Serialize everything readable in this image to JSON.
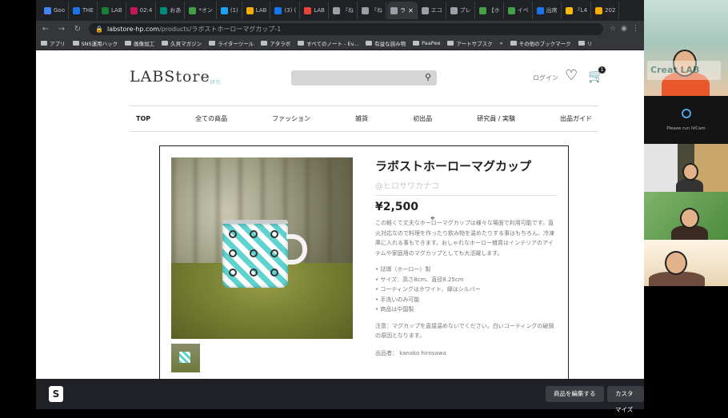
{
  "tabs": [
    {
      "label": "Goo",
      "color": "#4285f4"
    },
    {
      "label": "THE",
      "color": "#1a73e8"
    },
    {
      "label": "LAB",
      "color": "#188038"
    },
    {
      "label": "02:4",
      "color": "#c2185b"
    },
    {
      "label": "おあ",
      "color": "#00897b"
    },
    {
      "label": "*オン",
      "color": "#43a047"
    },
    {
      "label": "(1) ",
      "color": "#1da1f2"
    },
    {
      "label": "LAB",
      "color": "#f9ab00"
    },
    {
      "label": "(3) (",
      "color": "#1877f2"
    },
    {
      "label": "LAB",
      "color": "#ea4335"
    },
    {
      "label": "『ね",
      "color": "#9aa0a6"
    },
    {
      "label": "『ね",
      "color": "#9aa0a6"
    },
    {
      "label": "ラ",
      "color": "#9aa0a6",
      "active": true
    },
    {
      "label": "エコ",
      "color": "#9aa0a6"
    },
    {
      "label": "プレ",
      "color": "#9aa0a6"
    },
    {
      "label": "【ホ",
      "color": "#43a047"
    },
    {
      "label": "イベ",
      "color": "#43a047"
    },
    {
      "label": "出席",
      "color": "#1a73e8"
    },
    {
      "label": "『L4",
      "color": "#fbbc04"
    },
    {
      "label": "202",
      "color": "#f9ab00"
    }
  ],
  "address": {
    "host": "labstore-hp.com",
    "path": "/products/ラボストホーローマグカップ-1"
  },
  "bookmarks": [
    "アプリ",
    "SNS運用ハック",
    "画像加工",
    "久貝マガジン",
    "ライターツール",
    "アタラボ",
    "すべてのノート - Ev...",
    "有益な読み物",
    "PaaPee",
    "アートサブスク",
    "»",
    "その他のブックマーク",
    "リ"
  ],
  "header": {
    "logo": "LABStore",
    "logo_sub": "研究",
    "login": "ログイン",
    "cart_count": "1"
  },
  "nav": [
    "TOP",
    "全ての商品",
    "ファッション",
    "雑貨",
    "初出品",
    "研究員 / 実験",
    "出品ガイド"
  ],
  "product": {
    "title": "ラボストホーローマグカップ",
    "author": "@ヒロサワカナコ",
    "price": "¥2,500",
    "description": "この軽くて丈夫なホーローマグカップは様々な場面で利用可能です。直火対応なので料理を作ったり飲み物を温めたりする事はもちろん、冷凍庫に入れる事もできます。おしゃれなホーロー雑貨はインテリアのアイテムや家庭用のマグカップとしても大活躍します。",
    "specs": [
      "• 琺瑯（ホーロー）製",
      "• サイズ：高さ8cm、直径8.25cm",
      "• コーティングはホワイト、縁はシルバー",
      "• 手洗いのみ可能",
      "• 商品は中国製"
    ],
    "note": "注意：マグカップを直接温めないでください。白いコーティングの破損の原因となります。",
    "exhibitor": "出品者： kanako hirosawa"
  },
  "admin_bar": {
    "edit_label": "商品を編集する",
    "customize_label": "カスタマイズ",
    "close": "✕"
  },
  "video": {
    "brand_text": "Creat LAB",
    "ivcam_text": "Please run iVCam"
  }
}
